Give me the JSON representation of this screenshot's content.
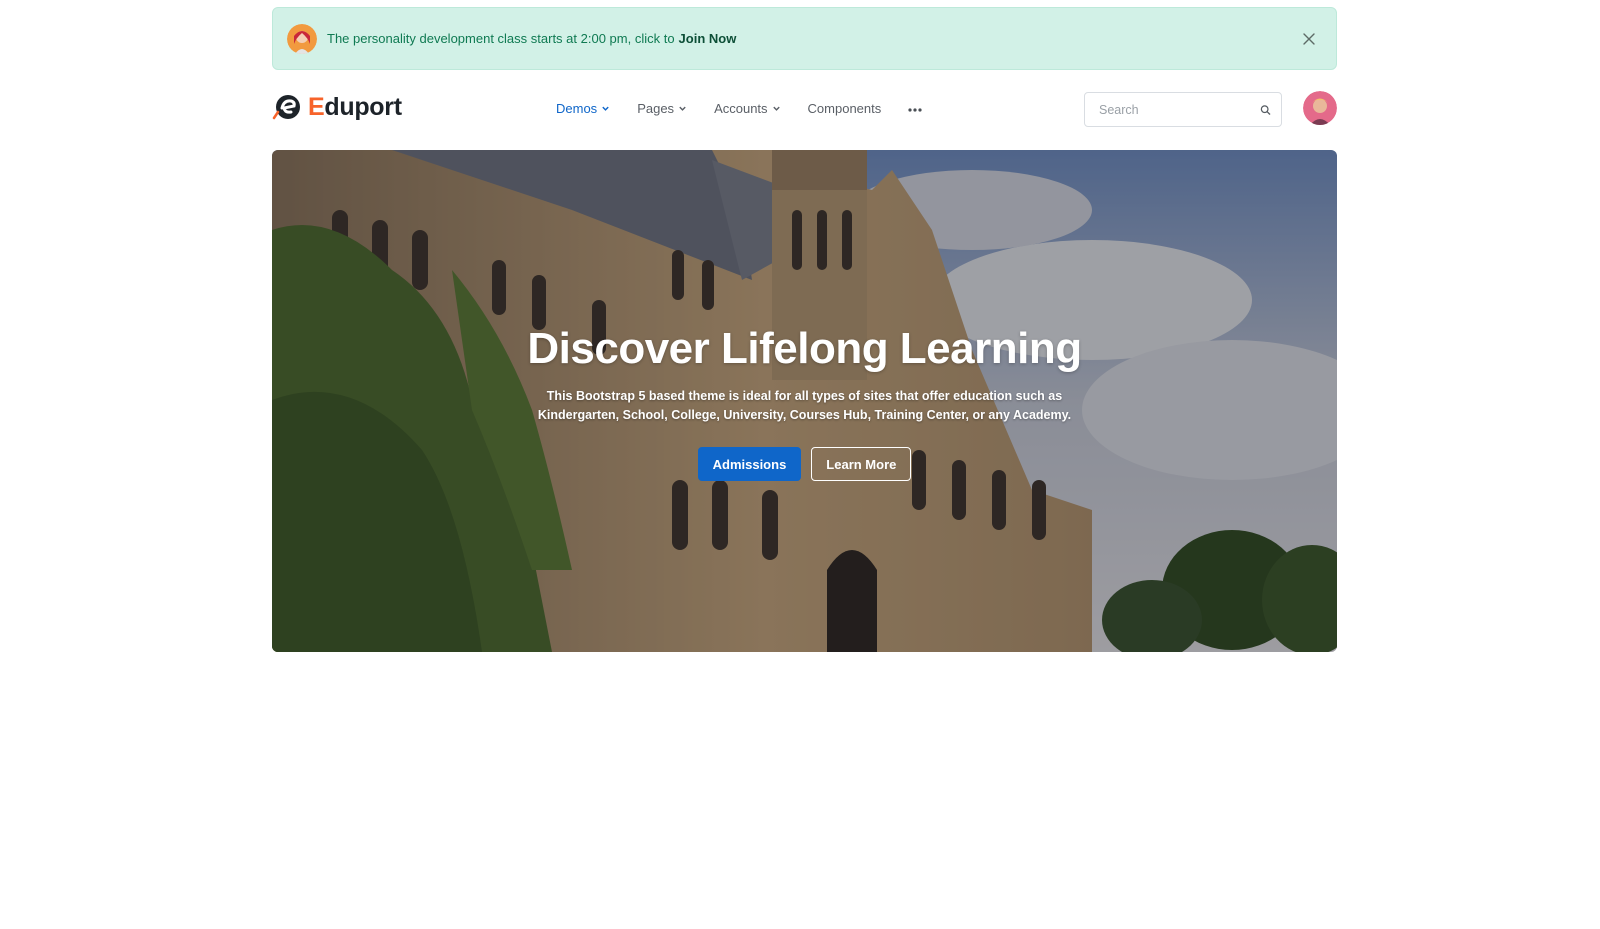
{
  "alert": {
    "message": "The personality development class starts at 2:00 pm, click to",
    "link": "Join Now"
  },
  "brand": {
    "first_letter": "E",
    "rest": "duport",
    "accent": "#f7632a"
  },
  "nav": {
    "items": [
      {
        "label": "Demos",
        "active": true,
        "dropdown": true
      },
      {
        "label": "Pages",
        "active": false,
        "dropdown": true
      },
      {
        "label": "Accounts",
        "active": false,
        "dropdown": true
      },
      {
        "label": "Components",
        "active": false,
        "dropdown": false
      }
    ],
    "more_icon": "ellipsis-icon"
  },
  "search": {
    "placeholder": "Search",
    "icon": "search-icon"
  },
  "hero": {
    "title": "Discover Lifelong Learning",
    "subtitle": "This Bootstrap 5 based theme is ideal for all types of sites that offer education such as Kindergarten, School, College, University, Courses Hub, Training Center, or any Academy.",
    "primary_button": "Admissions",
    "secondary_button": "Learn More"
  },
  "colors": {
    "primary": "#0f66c9",
    "alert_bg": "#d2f1e7",
    "alert_text": "#0f7a52"
  }
}
